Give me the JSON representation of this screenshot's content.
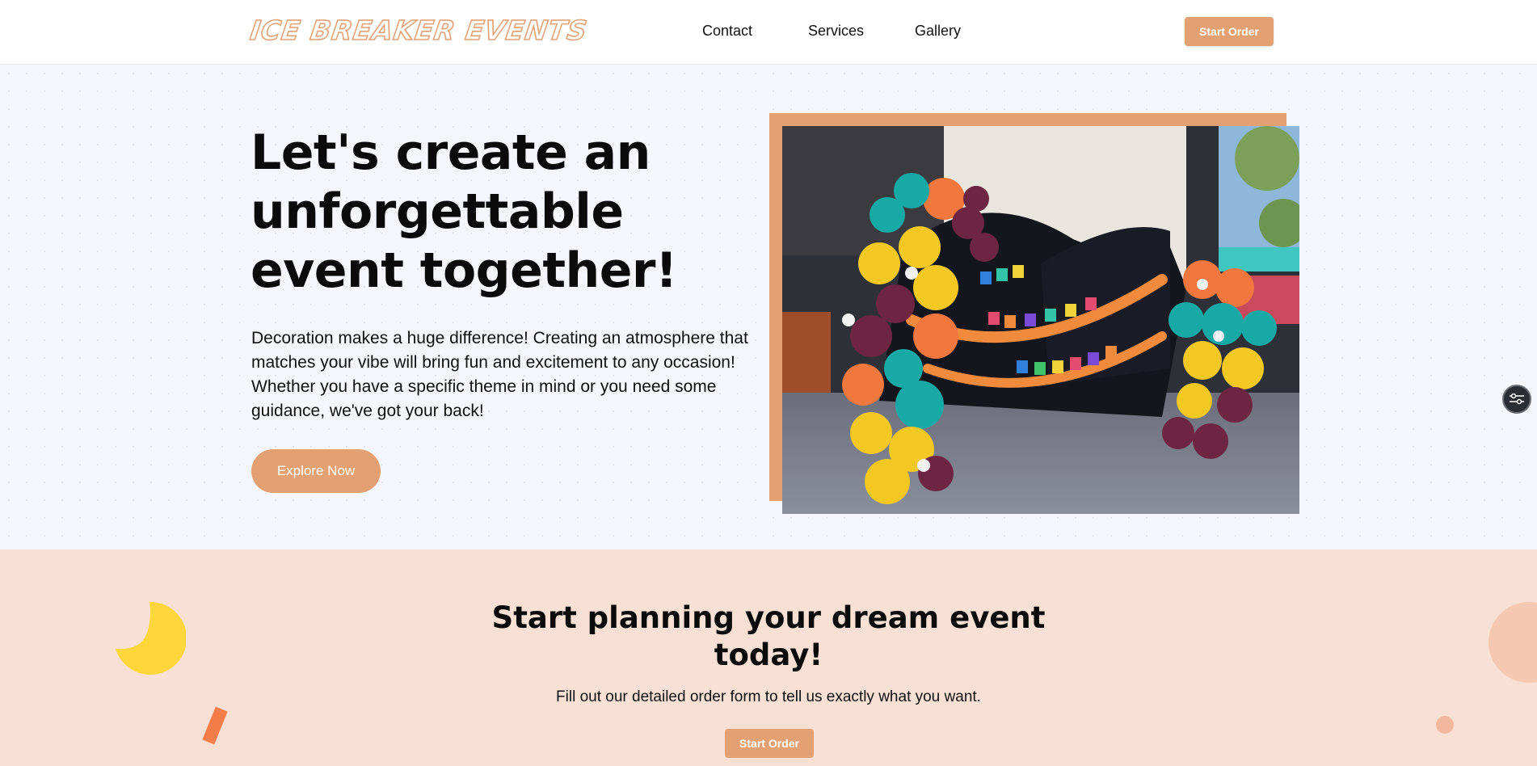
{
  "header": {
    "logo_text": "ICE BREAKER EVENTS",
    "nav": [
      "Contact",
      "Services",
      "Gallery"
    ],
    "start_order_label": "Start Order"
  },
  "hero": {
    "title": "Let's create an unforgettable event together!",
    "description": "Decoration makes a huge difference! Creating an atmosphere that matches your vibe will bring fun and excitement to any occasion! Whether you have a specific theme in mind or you need some guidance, we've got your back!",
    "cta_label": "Explore Now"
  },
  "cta_section": {
    "title": "Start planning your dream event today!",
    "subtitle": "Fill out our detailed order form to tell us exactly what you want.",
    "button_label": "Start Order"
  },
  "colors": {
    "accent": "#e3a173",
    "hero_bg": "#f5f6fb",
    "cta_bg": "#f8e0d4",
    "deco_yellow": "#fcd63a",
    "deco_orange": "#f47d4a"
  },
  "icons": {
    "floating_button": "sliders-icon"
  }
}
